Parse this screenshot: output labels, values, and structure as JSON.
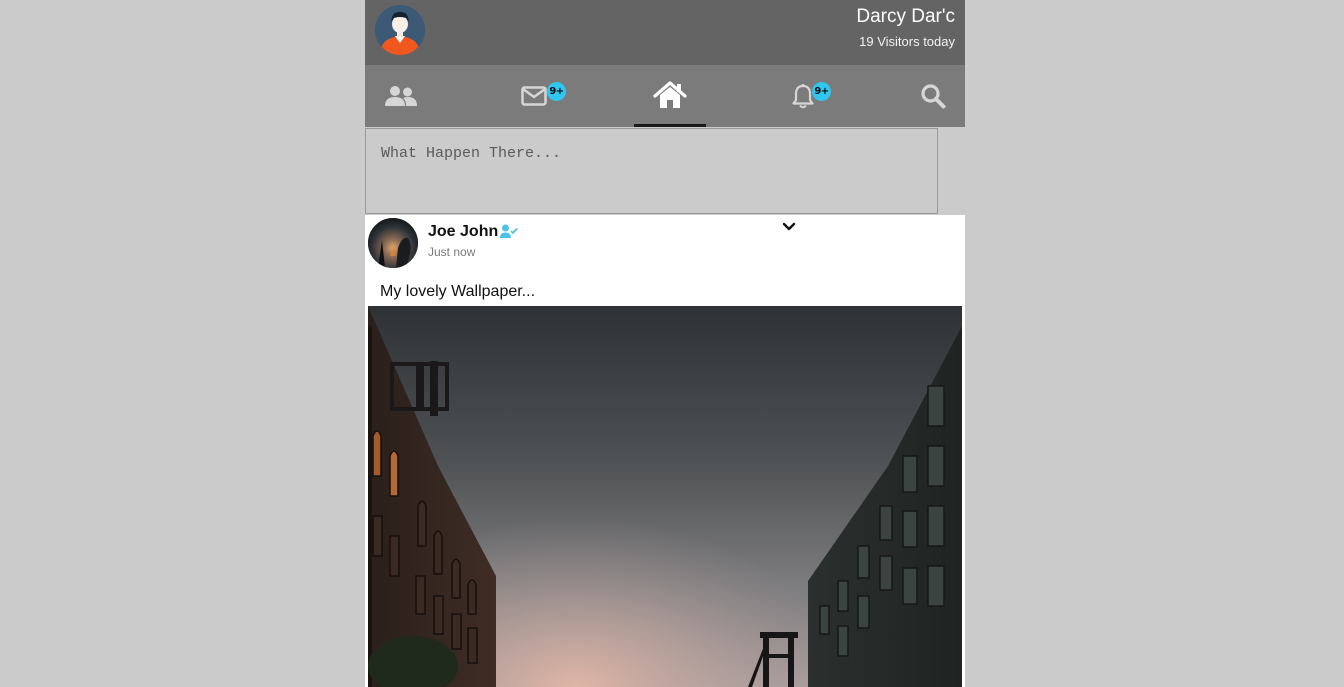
{
  "header": {
    "user_name": "Darcy Dar'c",
    "visitors_text": "19 Visitors today"
  },
  "nav": {
    "items": [
      {
        "name": "friends",
        "icon": "users-icon",
        "active": false
      },
      {
        "name": "messages",
        "icon": "envelope-icon",
        "badge": "9+",
        "active": false
      },
      {
        "name": "home",
        "icon": "home-icon",
        "active": true
      },
      {
        "name": "notifications",
        "icon": "bell-icon",
        "badge": "9+",
        "active": false
      },
      {
        "name": "search",
        "icon": "search-icon",
        "active": false
      }
    ]
  },
  "composer": {
    "placeholder": "What Happen There...",
    "value": ""
  },
  "post": {
    "author": "Joe John",
    "verified_icon": "user-check-icon",
    "time": "Just now",
    "caption": "My lovely Wallpaper...",
    "menu_icon": "chevron-down-icon",
    "image": "city-street-bridge-photo"
  },
  "colors": {
    "page_bg": "#cbcbcb",
    "header_bg": "#646464",
    "nav_bg": "#7b7b7b",
    "badge": "#2fc6f0",
    "verified": "#4cc2ea",
    "avatar_bg": "#3c5a76",
    "avatar_shirt": "#f0581e"
  }
}
